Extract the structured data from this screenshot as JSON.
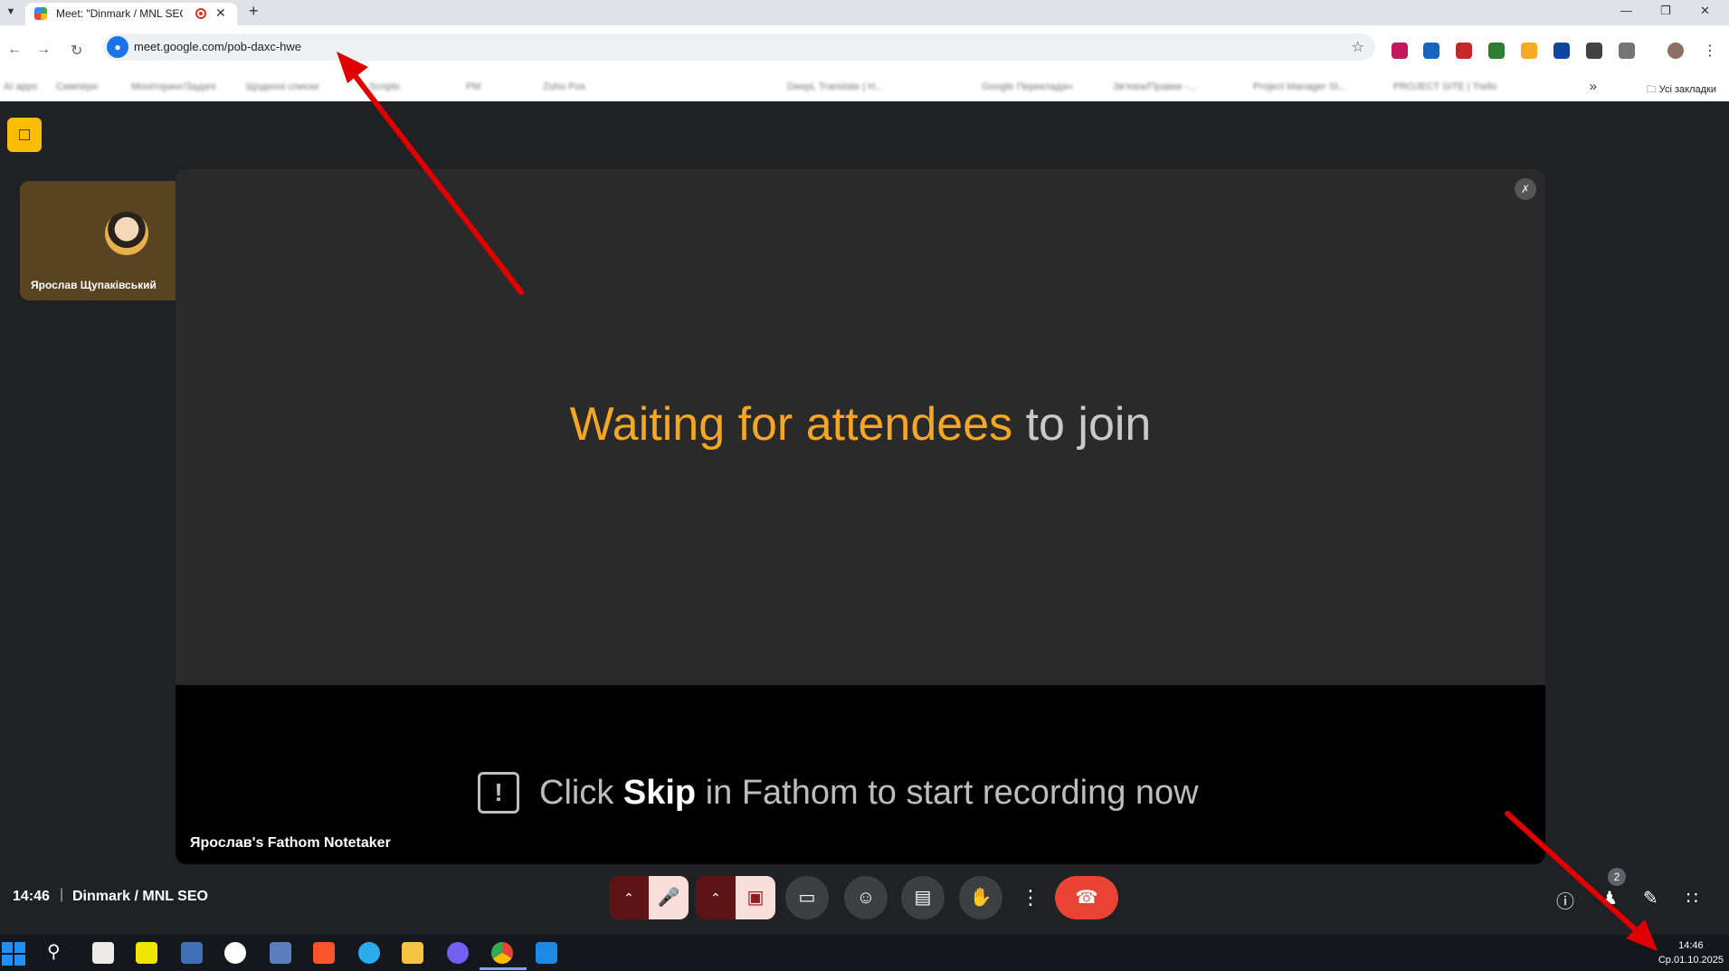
{
  "browser": {
    "tab": {
      "title": "Meet: \"Dinmark / MNL SEO"
    },
    "url": "meet.google.com/pob-daxc-hwe",
    "bookmarks": [
      "AI apps",
      "Семпери",
      "Моніторинг/Задачі",
      "Щоденні списки",
      "Scripts",
      "PM",
      "Zoho Pos",
      "DeepL Translate | Н...",
      "Google Перекладач",
      "Зв'язок/Правки -...",
      "Project Manager St...",
      "PROJECT SITE | Trello"
    ],
    "all_bookmarks_label": "Усі закладки"
  },
  "meet": {
    "self_tile_name": "Ярослав Щупаківський",
    "waiting_highlight": "Waiting for attendees",
    "waiting_rest": "to join",
    "hint_pre": "Click",
    "hint_bold": "Skip",
    "hint_post": "in Fathom to start recording now",
    "main_tile_name": "Ярослав's Fathom Notetaker",
    "time": "14:46",
    "separator": "|",
    "meeting_title": "Dinmark / MNL SEO",
    "people_count": "2"
  },
  "taskbar": {
    "clock_time": "14:46",
    "clock_date": "Ср.01.10.2025"
  },
  "colors": {
    "accent_orange": "#f5a623",
    "end_call_red": "#ea4335",
    "arrow_red": "#e00000"
  }
}
